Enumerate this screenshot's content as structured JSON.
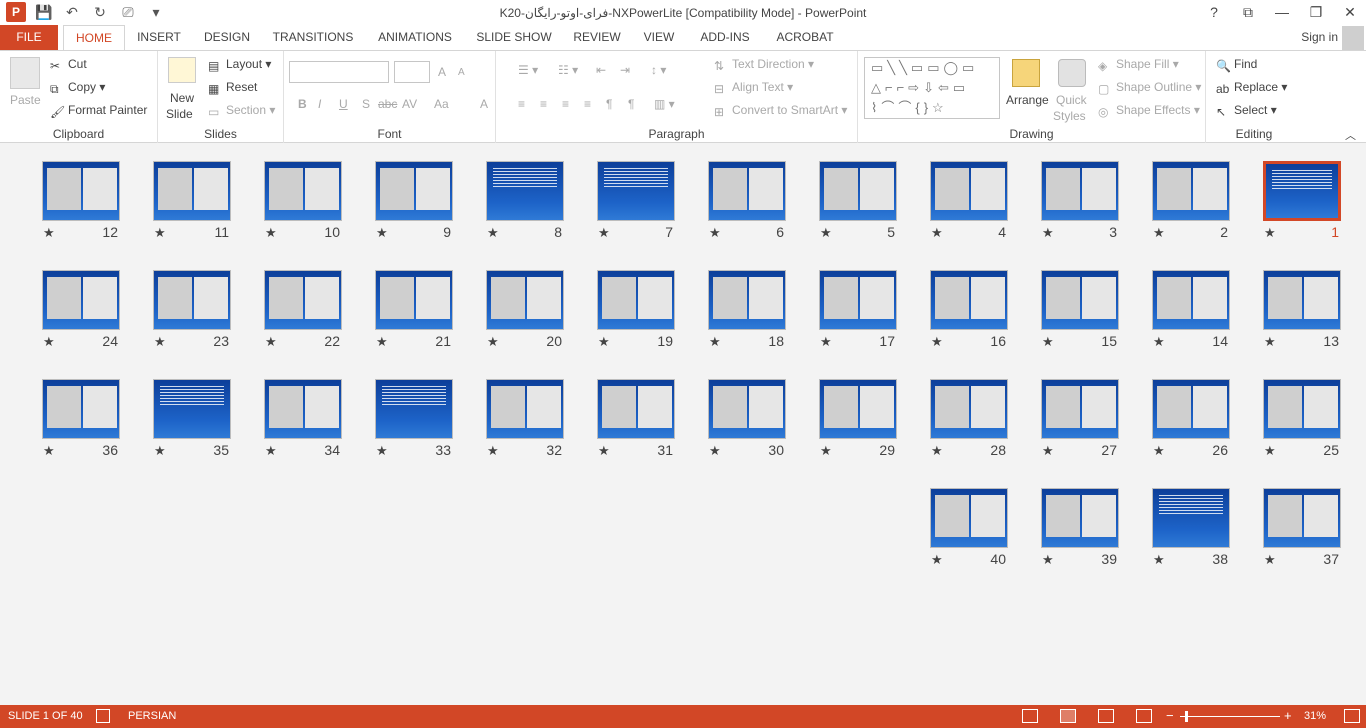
{
  "window": {
    "title": "K20-فرای-اوتو-رایگان-NXPowerLite [Compatibility Mode] - PowerPoint",
    "logo": "P",
    "help": "?",
    "restore_ribbon": "⧉",
    "minimize": "—",
    "maximize": "❐",
    "close": "✕"
  },
  "tabs": [
    "FILE",
    "HOME",
    "INSERT",
    "DESIGN",
    "TRANSITIONS",
    "ANIMATIONS",
    "SLIDE SHOW",
    "REVIEW",
    "VIEW",
    "ADD-INS",
    "ACROBAT"
  ],
  "signin": "Sign in",
  "clipboard": {
    "paste": "Paste",
    "cut": "Cut",
    "copy": "Copy",
    "format_painter": "Format Painter",
    "label": "Clipboard"
  },
  "slides_group": {
    "new_slide_line1": "New",
    "new_slide_line2": "Slide",
    "layout": "Layout",
    "reset": "Reset",
    "section": "Section",
    "label": "Slides"
  },
  "font": {
    "label": "Font",
    "bold": "B",
    "italic": "I",
    "underline": "U",
    "shadow": "S",
    "strike": "abc",
    "spacing": "AV",
    "case": "Aa",
    "color": "A",
    "grow": "A",
    "shrink": "A"
  },
  "paragraph": {
    "label": "Paragraph",
    "text_direction": "Text Direction",
    "align_text": "Align Text",
    "convert_smartart": "Convert to SmartArt"
  },
  "drawing": {
    "label": "Drawing",
    "arrange": "Arrange",
    "quick_styles_line1": "Quick",
    "quick_styles_line2": "Styles",
    "shape_fill": "Shape Fill",
    "shape_outline": "Shape Outline",
    "shape_effects": "Shape Effects"
  },
  "editing": {
    "label": "Editing",
    "find": "Find",
    "replace": "Replace",
    "select": "Select"
  },
  "slide_rows": [
    [
      "12",
      "11",
      "10",
      "9",
      "8",
      "7",
      "6",
      "5",
      "4",
      "3",
      "2",
      "1"
    ],
    [
      "24",
      "23",
      "22",
      "21",
      "20",
      "19",
      "18",
      "17",
      "16",
      "15",
      "14",
      "13"
    ],
    [
      "36",
      "35",
      "34",
      "33",
      "32",
      "31",
      "30",
      "29",
      "28",
      "27",
      "26",
      "25"
    ],
    [
      "40",
      "39",
      "38",
      "37"
    ]
  ],
  "star": "★",
  "selected_slide": "1",
  "status": {
    "slide_info": "SLIDE 1 OF 40",
    "language": "PERSIAN",
    "zoom": "31%",
    "zoom_out": "−",
    "zoom_in": "+"
  },
  "colors": {
    "accent": "#d24726",
    "slide_bg": "#1d63c8"
  }
}
